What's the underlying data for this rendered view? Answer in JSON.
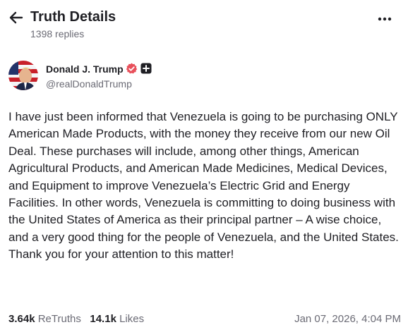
{
  "header": {
    "title": "Truth Details",
    "replies": "1398 replies",
    "back_icon": "arrow-left-icon",
    "more_icon": "more-horizontal-icon"
  },
  "post": {
    "author_name": "Donald J. Trump",
    "handle": "@realDonaldTrump",
    "verified_color": "#e8505b",
    "body": "I have just been informed that Venezuela is going to be purchasing ONLY American Made Products, with the money they receive from our new Oil Deal. These purchases will include, among other things, American Agricultural Products, and American Made Medicines, Medical Devices, and Equipment to improve Venezuela’s Electric Grid and Energy Facilities. In other words, Venezuela is committing to doing business with the United States of America as their principal partner – A wise choice, and a very good thing for the people of Venezuela, and the United States. Thank you for your attention to this matter!",
    "retruths_count": "3.64k",
    "retruths_label": "ReTruths",
    "likes_count": "14.1k",
    "likes_label": "Likes",
    "timestamp": "Jan 07, 2026, 4:04 PM"
  }
}
